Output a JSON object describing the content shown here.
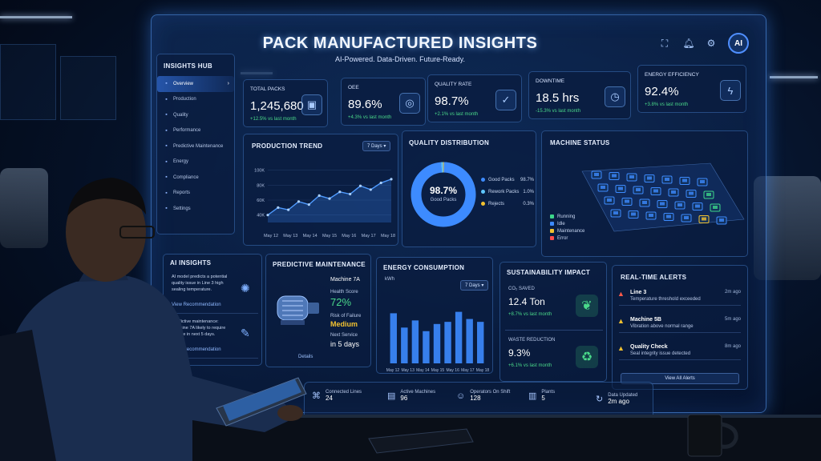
{
  "header": {
    "title": "PACK MANUFACTURED INSIGHTS",
    "subtitle": "AI-Powered. Data-Driven. Future-Ready.",
    "avatar": "AI",
    "icons": [
      "expand-icon",
      "bell-icon",
      "gear-icon"
    ]
  },
  "sidebar": {
    "title": "INSIGHTS HUB",
    "items": [
      {
        "label": "Overview",
        "icon": "grid-icon",
        "active": true
      },
      {
        "label": "Production",
        "icon": "factory-icon"
      },
      {
        "label": "Quality",
        "icon": "shield-icon"
      },
      {
        "label": "Performance",
        "icon": "gauge-icon"
      },
      {
        "label": "Predictive Maintenance",
        "icon": "wrench-icon"
      },
      {
        "label": "Energy",
        "icon": "bolt-icon"
      },
      {
        "label": "Compliance",
        "icon": "check-icon"
      },
      {
        "label": "Reports",
        "icon": "report-icon"
      },
      {
        "label": "Settings",
        "icon": "gear-icon"
      }
    ]
  },
  "kpis": [
    {
      "label": "TOTAL PACKS",
      "value": "1,245,680",
      "delta": "+12.5% vs last month",
      "icon": "box-icon",
      "delta_color": "#4ad98a"
    },
    {
      "label": "OEE",
      "value": "89.6%",
      "delta": "+4.3% vs last month",
      "icon": "target-icon",
      "delta_color": "#4ad98a"
    },
    {
      "label": "QUALITY RATE",
      "value": "98.7%",
      "delta": "+2.1% vs last month",
      "icon": "badge-icon",
      "delta_color": "#4ad98a"
    },
    {
      "label": "DOWNTIME",
      "value": "18.5 hrs",
      "delta": "-15.3% vs last month",
      "icon": "clock-icon",
      "delta_color": "#4ad98a"
    },
    {
      "label": "ENERGY EFFICIENCY",
      "value": "92.4%",
      "delta": "+3.8% vs last month",
      "icon": "bolt-icon",
      "delta_color": "#4ad98a"
    }
  ],
  "production_trend": {
    "title": "PRODUCTION TREND",
    "range": "7 Days",
    "yticks": [
      "100K",
      "80K",
      "60K",
      "40K"
    ],
    "xticks": [
      "May 12",
      "May 13",
      "May 14",
      "May 15",
      "May 16",
      "May 17",
      "May 18"
    ]
  },
  "quality_distribution": {
    "title": "QUALITY DISTRIBUTION",
    "center_value": "98.7%",
    "center_label": "Good Packs",
    "items": [
      {
        "label": "Good Packs",
        "value": "98.7%",
        "color": "#3d8bff",
        "pct": 98.7
      },
      {
        "label": "Rework Packs",
        "value": "1.0%",
        "color": "#5fc8ff",
        "pct": 1.0
      },
      {
        "label": "Rejects",
        "value": "0.3%",
        "color": "#f2c230",
        "pct": 0.3
      }
    ]
  },
  "machine_status": {
    "title": "MACHINE STATUS",
    "legend": [
      {
        "label": "Running",
        "color": "#3cd68a"
      },
      {
        "label": "Idle",
        "color": "#3d8bff"
      },
      {
        "label": "Maintenance",
        "color": "#f2c230"
      },
      {
        "label": "Error",
        "color": "#ff4b4b"
      }
    ]
  },
  "ai_insights": {
    "title": "AI INSIGHTS",
    "items": [
      {
        "text": "AI model predicts a potential quality issue in Line 3 high sealing temperature.",
        "link": "View Recommendation",
        "icon": "brain-icon"
      },
      {
        "text": "Predictive maintenance: Machine 7A likely to require service in next 5 days.",
        "link": "View Recommendation",
        "icon": "wrench-icon"
      }
    ]
  },
  "predictive_maintenance": {
    "title": "PREDICTIVE MAINTENANCE",
    "machine": "Machine 7A",
    "health_label": "Health Score",
    "health_value": "72%",
    "risk_label": "Risk of Failure",
    "risk_value": "Medium",
    "next_label": "Next Service",
    "next_value": "in 5 days",
    "details": "Details"
  },
  "energy": {
    "title": "ENERGY CONSUMPTION",
    "unit": "kWh",
    "range": "7 Days",
    "xticks": [
      "May 12",
      "May 13",
      "May 14",
      "May 15",
      "May 16",
      "May 17",
      "May 18"
    ]
  },
  "sustainability": {
    "title": "SUSTAINABILITY IMPACT",
    "co2_label": "CO₂ SAVED",
    "co2_value": "12.4 Ton",
    "co2_delta": "+8.7% vs last month",
    "waste_label": "WASTE REDUCTION",
    "waste_value": "9.3%",
    "waste_delta": "+6.1% vs last month",
    "icons": [
      "leaf-icon",
      "recycle-icon"
    ]
  },
  "alerts": {
    "title": "REAL-TIME ALERTS",
    "items": [
      {
        "title": "Line 3",
        "desc": "Temperature threshold exceeded",
        "time": "2m ago",
        "color": "#ff5a4a"
      },
      {
        "title": "Machine 5B",
        "desc": "Vibration above normal range",
        "time": "5m ago",
        "color": "#f2c230"
      },
      {
        "title": "Quality Check",
        "desc": "Seal integrity issue detected",
        "time": "8m ago",
        "color": "#f2c230"
      }
    ],
    "view_all": "View All Alerts"
  },
  "footer": [
    {
      "label": "Connected Lines",
      "value": "24",
      "icon": "network-icon"
    },
    {
      "label": "Active Machines",
      "value": "96",
      "icon": "machine-icon"
    },
    {
      "label": "Operators On Shift",
      "value": "128",
      "icon": "user-icon"
    },
    {
      "label": "Plants",
      "value": "5",
      "icon": "building-icon"
    },
    {
      "label": "Data Updated",
      "value": "2m ago",
      "icon": "refresh-icon"
    }
  ],
  "chart_data": [
    {
      "type": "line",
      "title": "PRODUCTION TREND",
      "x": [
        "May 12",
        "",
        "May 13",
        "",
        "May 14",
        "",
        "May 15",
        "",
        "May 16",
        "",
        "May 17",
        "",
        "May 18"
      ],
      "ylim": [
        30000,
        105000
      ],
      "values": [
        40000,
        50000,
        47000,
        58000,
        54000,
        66000,
        62000,
        71000,
        68000,
        79000,
        74000,
        83000,
        88000
      ]
    },
    {
      "type": "pie",
      "title": "QUALITY DISTRIBUTION",
      "categories": [
        "Good Packs",
        "Rework Packs",
        "Rejects"
      ],
      "values": [
        98.7,
        1.0,
        0.3
      ]
    },
    {
      "type": "bar",
      "title": "ENERGY CONSUMPTION",
      "categories": [
        "May 12",
        "May 12b",
        "May 13",
        "May 14",
        "May 14b",
        "May 15",
        "May 16",
        "May 17",
        "May 18"
      ],
      "values": [
        70,
        50,
        60,
        45,
        55,
        58,
        72,
        62,
        58
      ],
      "ylim": [
        0,
        85
      ]
    }
  ]
}
